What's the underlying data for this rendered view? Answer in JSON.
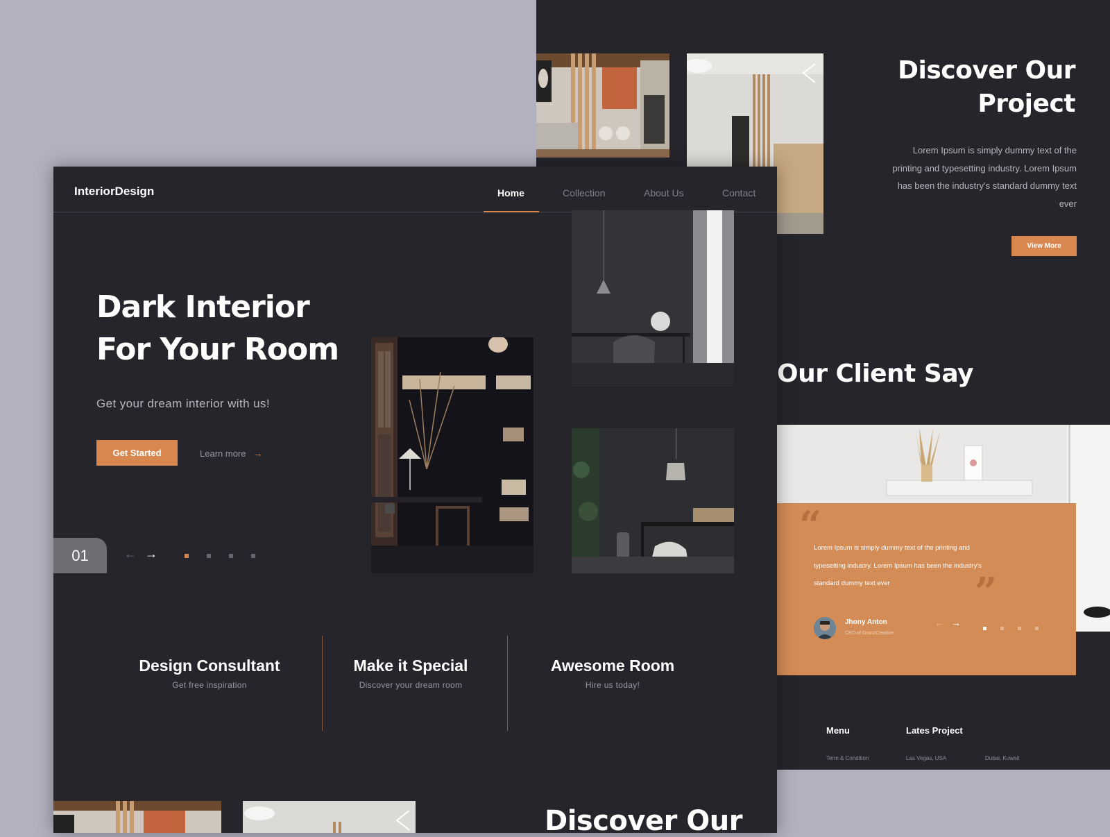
{
  "back": {
    "discover_title_line1": "Discover Our",
    "discover_title_line2": "Project",
    "discover_body": "Lorem Ipsum is simply dummy text of the printing and typesetting industry. Lorem Ipsum has been the industry's standard dummy text ever",
    "view_more": "View More",
    "client_title": "Our Client Say",
    "testimonial": {
      "text": "Lorem Ipsum is simply dummy text of the printing and typesetting industry. Lorem Ipsum has been the industry's standard dummy text ever",
      "name": "Jhony Anton",
      "role": "CEO of GranzCreative"
    },
    "footer": {
      "menu_heading": "Menu",
      "project_heading": "Lates Project",
      "link1": "Term & Condition",
      "link2": "Las Vegas, USA",
      "link3": "Dubai, Kuwait"
    }
  },
  "front": {
    "logo": "InteriorDesign",
    "nav": [
      "Home",
      "Collection",
      "About Us",
      "Contact"
    ],
    "hero_title_line1": "Dark Interior",
    "hero_title_line2": "For Your Room",
    "hero_subtitle": "Get your dream interior with us!",
    "get_started": "Get Started",
    "learn_more": "Learn more",
    "slide_number": "01",
    "features": [
      {
        "title": "Design Consultant",
        "subtitle": "Get free inspiration"
      },
      {
        "title": "Make it Special",
        "subtitle": "Discover your dream room"
      },
      {
        "title": "Awesome Room",
        "subtitle": "Hire us today!"
      }
    ],
    "bottom_title": "Discover Our"
  },
  "colors": {
    "accent": "#d8874f",
    "panel": "#26252c",
    "background": "#b2b1bf"
  }
}
